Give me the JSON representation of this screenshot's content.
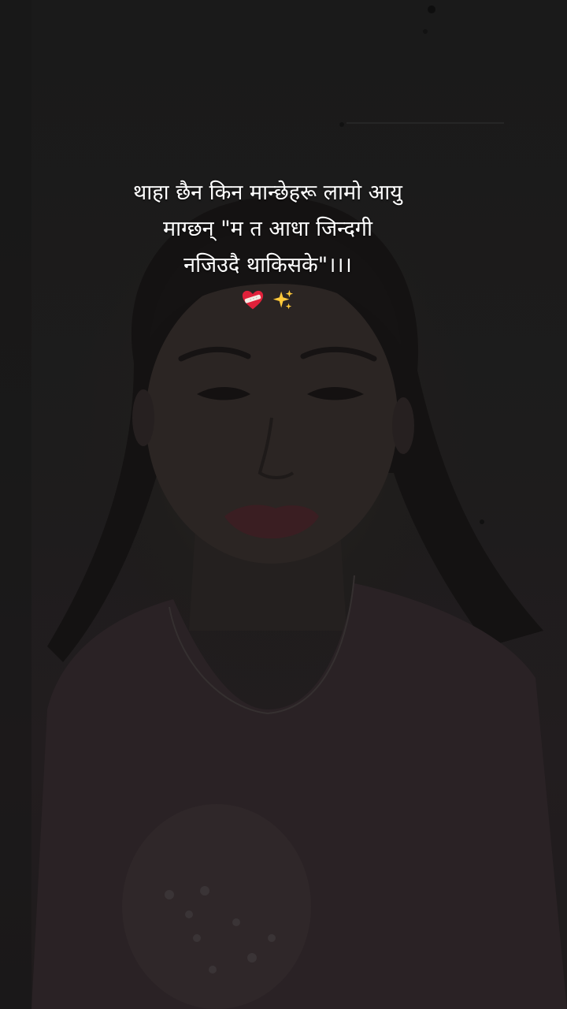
{
  "caption": {
    "lines": [
      "थाहा छैन किन मान्छेहरू लामो आयु",
      "माग्छन् \"म त आधा जिन्दगी",
      "नजिउदै थाकिसके\"।।।"
    ],
    "emojis": [
      "heart-with-bandage-icon",
      "sparkles-icon"
    ]
  },
  "colors": {
    "background": "#1b1b1b",
    "caption_text": "#ffffff",
    "shirt": "#2a2225"
  }
}
